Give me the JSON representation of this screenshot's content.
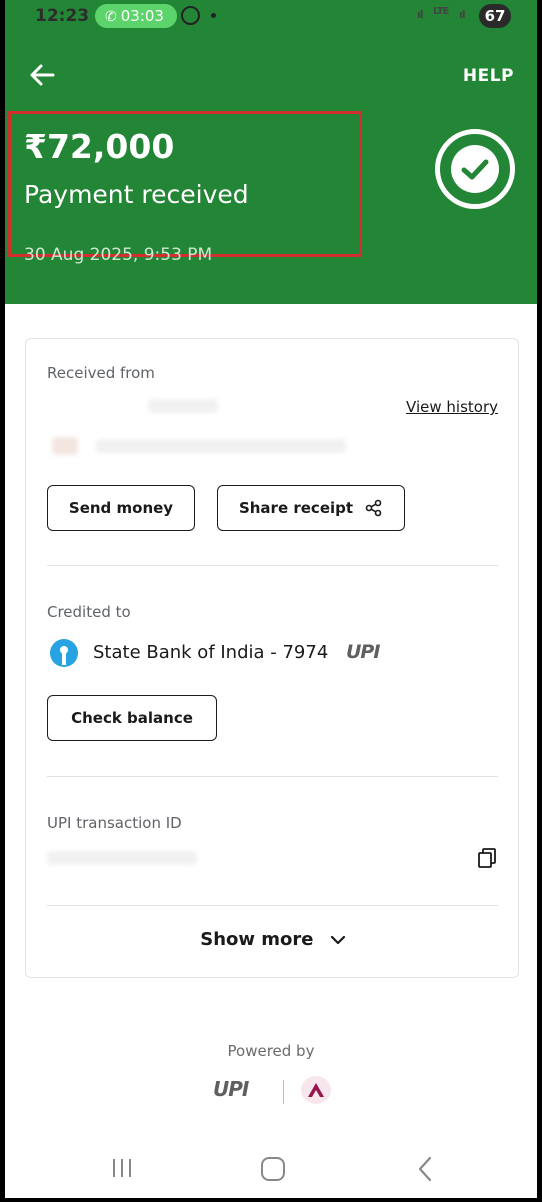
{
  "status_bar": {
    "time": "12:23",
    "call_timer": "03:03",
    "signal_label_1": "ıl",
    "network_type": "LTE",
    "signal_label_2": "ıl",
    "battery": "67"
  },
  "header": {
    "help_label": "HELP",
    "amount": "₹72,000",
    "status": "Payment received",
    "date": "30 Aug 2025, 9:53 PM",
    "bg_color": "#238636"
  },
  "received_from": {
    "label": "Received from",
    "view_history_label": "View history",
    "send_money_label": "Send money",
    "share_receipt_label": "Share receipt"
  },
  "credited_to": {
    "label": "Credited to",
    "bank": "State Bank of India - 7974",
    "upi_badge": "UPI",
    "check_balance_label": "Check balance"
  },
  "transaction": {
    "label": "UPI transaction ID"
  },
  "show_more_label": "Show more",
  "footer": {
    "powered_by": "Powered by",
    "upi_logo": "UPI"
  },
  "icons": {
    "back": "arrow-left-icon",
    "check": "check-circle-icon",
    "share": "share-icon",
    "copy": "copy-icon",
    "chevron": "chevron-down-icon"
  }
}
